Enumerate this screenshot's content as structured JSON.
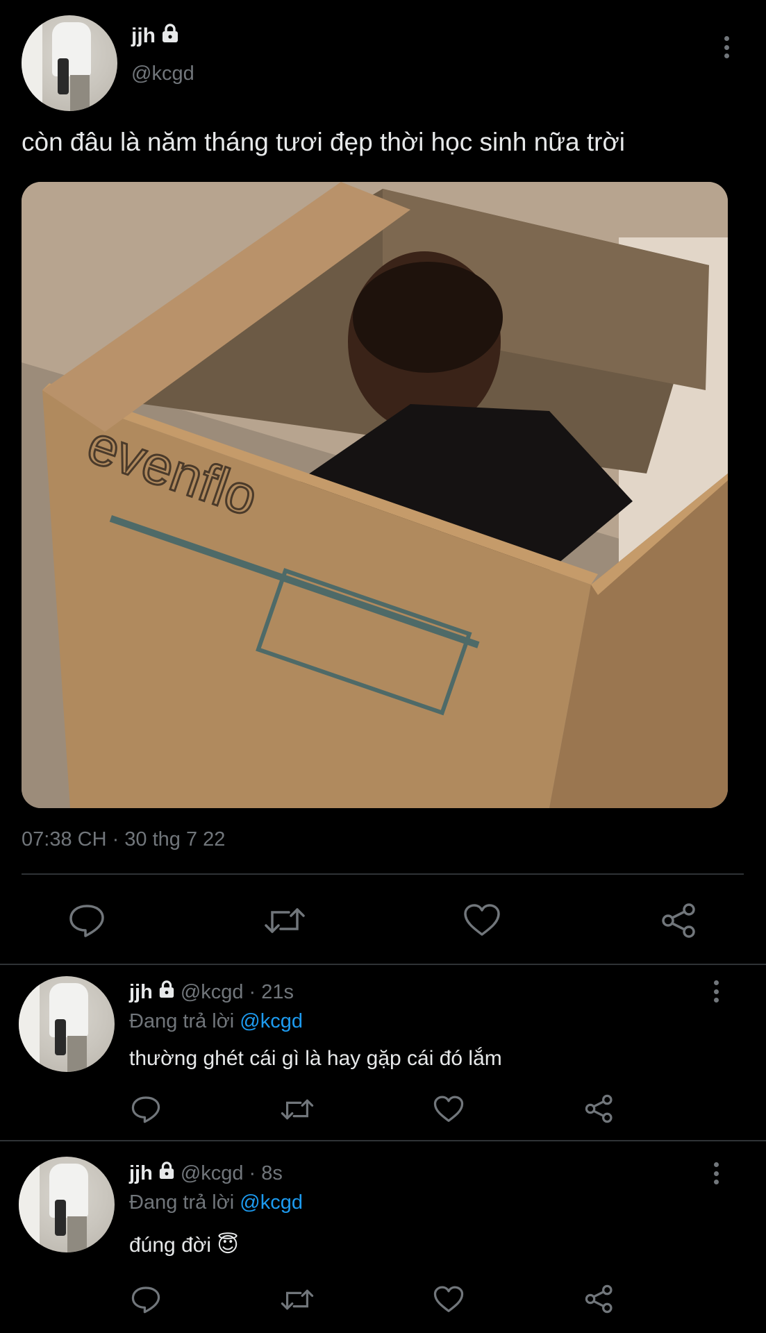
{
  "main_tweet": {
    "name": "jjh",
    "handle": "@kcgd",
    "text": "còn đâu là năm tháng tươi đẹp thời học sinh nữa trời",
    "meta": "07:38 CH · 30 thg 7 22",
    "image_text": "evenflo"
  },
  "replies": [
    {
      "name": "jjh",
      "handle": "@kcgd",
      "time": "· 21s",
      "replying_prefix": "Đang trả lời",
      "replying_to": "@kcgd",
      "text": "thường ghét cái gì là hay gặp cái đó lắm"
    },
    {
      "name": "jjh",
      "handle": "@kcgd",
      "time": "· 8s",
      "replying_prefix": "Đang trả lời",
      "replying_to": "@kcgd",
      "text": "đúng đời 😇"
    }
  ],
  "colors": {
    "background": "#000000",
    "text": "#e7e9ea",
    "muted": "#71767b",
    "accent": "#1d9bf0",
    "divider": "#2f3336"
  },
  "icons": [
    "lock-icon",
    "more-icon",
    "reply-icon",
    "retweet-icon",
    "like-icon",
    "share-icon"
  ]
}
